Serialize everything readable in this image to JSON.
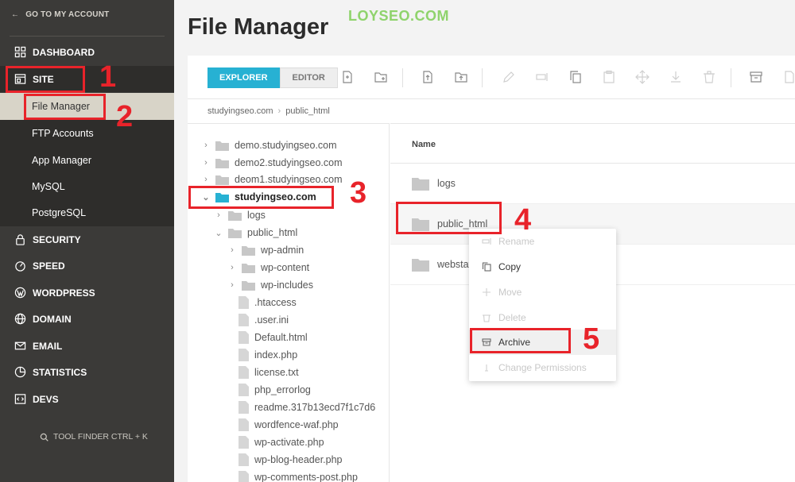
{
  "sidebar": {
    "goto_label": "GO TO MY ACCOUNT",
    "items": [
      {
        "label": "DASHBOARD",
        "icon": "grid-icon"
      },
      {
        "label": "SITE",
        "icon": "site-icon"
      },
      {
        "label": "SECURITY",
        "icon": "lock-icon"
      },
      {
        "label": "SPEED",
        "icon": "speed-icon"
      },
      {
        "label": "WORDPRESS",
        "icon": "wordpress-icon"
      },
      {
        "label": "DOMAIN",
        "icon": "globe-icon"
      },
      {
        "label": "EMAIL",
        "icon": "email-icon"
      },
      {
        "label": "STATISTICS",
        "icon": "pie-icon"
      },
      {
        "label": "DEVS",
        "icon": "code-icon"
      }
    ],
    "subitems": [
      "File Manager",
      "FTP Accounts",
      "App Manager",
      "MySQL",
      "PostgreSQL"
    ],
    "tool_finder": "TOOL FINDER CTRL + K"
  },
  "page": {
    "title": "File Manager",
    "watermark": "LOYSEO.COM"
  },
  "toolbar": {
    "tab_explorer": "EXPLORER",
    "tab_editor": "EDITOR"
  },
  "breadcrumb": {
    "root": "studyingseo.com",
    "sep": "›",
    "current": "public_html"
  },
  "tree": {
    "domains": [
      "demo.studyingseo.com",
      "demo2.studyingseo.com",
      "deom1.studyingseo.com",
      "studyingseo.com"
    ],
    "children": [
      "logs",
      "public_html"
    ],
    "public_html_folders": [
      "wp-admin",
      "wp-content",
      "wp-includes"
    ],
    "public_html_files": [
      ".htaccess",
      ".user.ini",
      "Default.html",
      "index.php",
      "license.txt",
      "php_errorlog",
      "readme.317b13ecd7f1c7d6",
      "wordfence-waf.php",
      "wp-activate.php",
      "wp-blog-header.php",
      "wp-comments-post.php"
    ]
  },
  "list": {
    "header_name": "Name",
    "rows": [
      "logs",
      "public_html",
      "webstat"
    ]
  },
  "context_menu": {
    "items": [
      {
        "label": "Rename",
        "disabled": true
      },
      {
        "label": "Copy",
        "disabled": false
      },
      {
        "label": "Move",
        "disabled": true
      },
      {
        "label": "Delete",
        "disabled": true
      },
      {
        "label": "Archive",
        "disabled": false
      },
      {
        "label": "Change Permissions",
        "disabled": true
      }
    ]
  },
  "annotations": [
    "1",
    "2",
    "3",
    "4",
    "5"
  ],
  "colors": {
    "accent": "#27b1d3",
    "sidebar_bg": "#3b3a38",
    "annotation_red": "#e8232a",
    "folder_grey": "#c7c7c7",
    "folder_selected": "#27b1d3"
  }
}
